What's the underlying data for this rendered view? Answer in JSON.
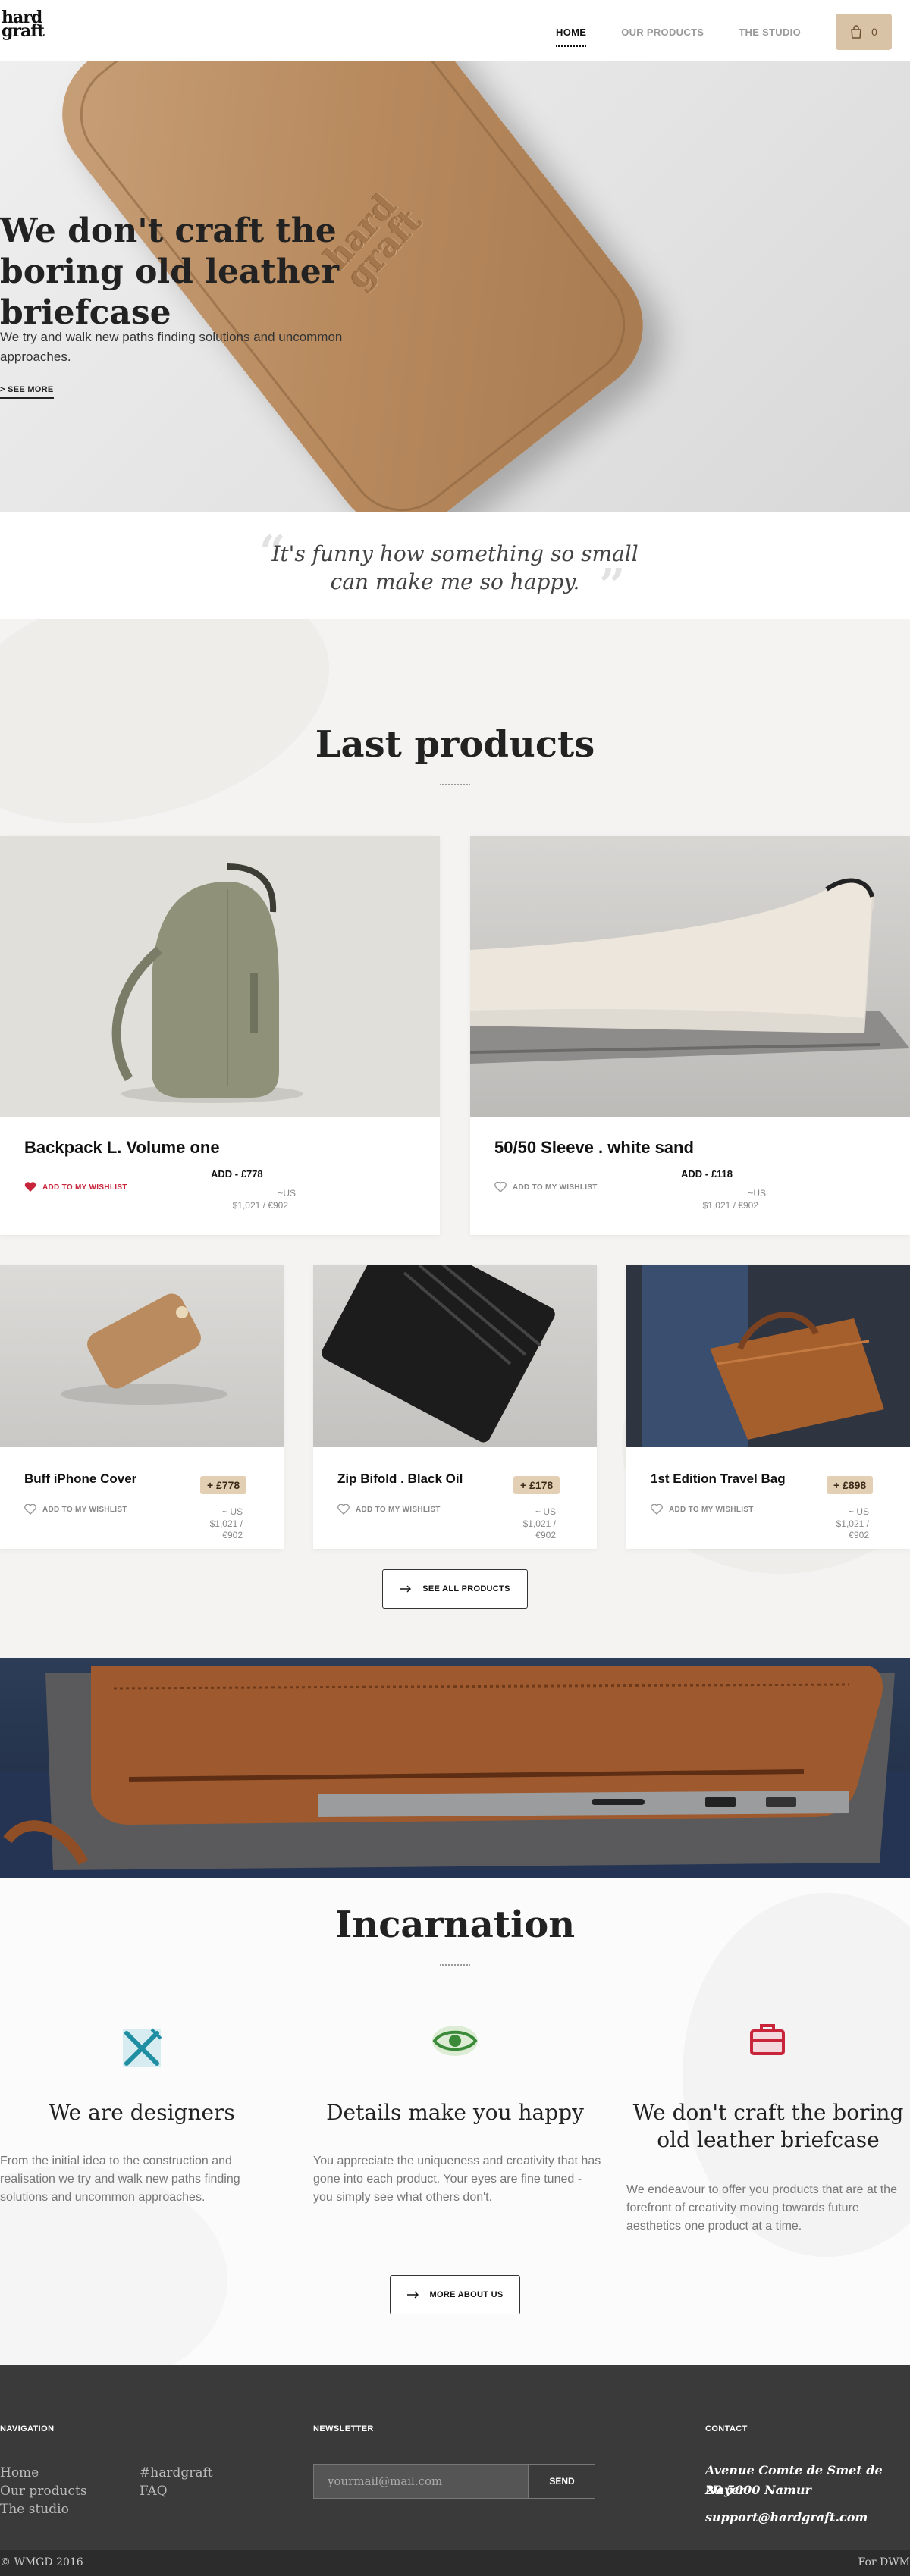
{
  "header": {
    "logo_line1": "hard",
    "logo_line2": "graft",
    "nav": [
      "HOME",
      "OUR PRODUCTS",
      "THE STUDIO"
    ],
    "cart_count": "0"
  },
  "hero": {
    "title": "We don't craft the boring old leather briefcase",
    "text": "We try and walk new paths finding solutions and uncommon approaches.",
    "more": "> SEE MORE",
    "emboss1": "hard",
    "emboss2": "graft"
  },
  "quote": {
    "line1": "It's funny how something so small",
    "line2": "can make me so happy."
  },
  "products": {
    "title": "Last products",
    "wishlist": "ADD TO MY WISHLIST",
    "large": [
      {
        "name": "Backpack L. Volume one",
        "add": "ADD - £778",
        "us": "~US",
        "price": "$1,021 / €902",
        "wished": true
      },
      {
        "name": "50/50 Sleeve . white sand",
        "add": "ADD - £118",
        "us": "~US",
        "price": "$1,021 / €902",
        "wished": false
      }
    ],
    "small": [
      {
        "name": "Buff iPhone Cover",
        "badge": "+ £778",
        "us": "~ US",
        "price1": "$1,021 /",
        "price2": "€902"
      },
      {
        "name": "Zip Bifold . Black Oil",
        "badge": "+ £178",
        "us": "~ US",
        "price1": "$1,021 /",
        "price2": "€902"
      },
      {
        "name": "1st Edition Travel Bag",
        "badge": "+ £898",
        "us": "~ US",
        "price1": "$1,021 /",
        "price2": "€902"
      }
    ],
    "see_all": "SEE ALL PRODUCTS"
  },
  "incarnation": {
    "title": "Incarnation",
    "features": [
      {
        "icon": "tools-icon",
        "title": "We are designers",
        "text": "From the initial idea to the construction and realisation we try and walk new paths finding solutions and uncommon approaches."
      },
      {
        "icon": "eye-icon",
        "title": "Details make you happy",
        "text": "You appreciate the uniqueness and creativity that has gone into each product. Your eyes are fine tuned - you simply see what others don't."
      },
      {
        "icon": "briefcase-icon",
        "title": "We don't craft the boring old leather briefcase",
        "text": "We endeavour to offer you products that are at the forefront of creativity moving towards future aesthetics one product at a time."
      }
    ],
    "more": "MORE ABOUT US"
  },
  "footer": {
    "nav_head": "NAVIGATION",
    "nav_col1": [
      "Home",
      "Our products",
      "The studio"
    ],
    "nav_col2": [
      "#hardgraft",
      "FAQ"
    ],
    "newsletter_head": "NEWSLETTER",
    "newsletter_placeholder": "yourmail@mail.com",
    "send": "SEND",
    "contact_head": "CONTACT",
    "address1": "Avenue Comte de Smet de Nayer",
    "address2": "20 5000 Namur",
    "email": "support@hardgraft.com",
    "copyright": "© WMGD 2016",
    "credit": "For DWM"
  },
  "colors": {
    "accent": "#d9c3a6",
    "wishlist_active": "#c8243a",
    "icon_blue": "#1f8ea3",
    "icon_green": "#3a8a3a",
    "icon_red": "#c8243a"
  }
}
